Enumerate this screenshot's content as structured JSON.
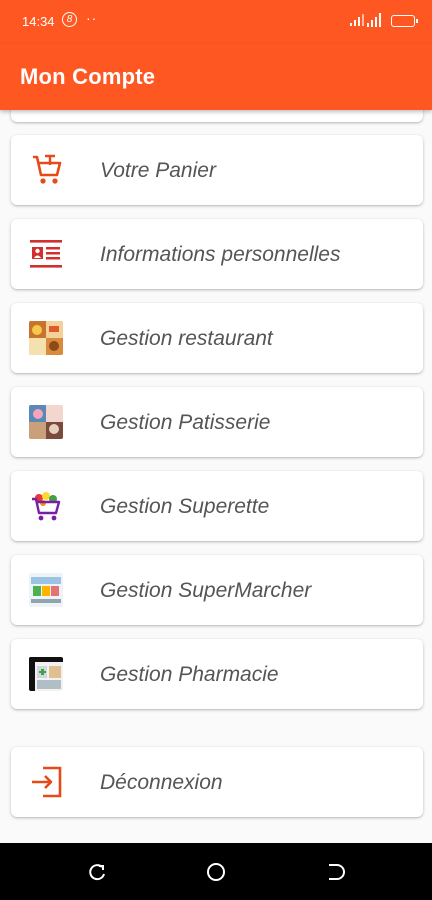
{
  "status_bar": {
    "time": "14:34",
    "badge": "8",
    "dots": "··"
  },
  "app_bar": {
    "title": "Mon Compte"
  },
  "menu": [
    {
      "label": "Votre Panier",
      "icon": "cart-icon"
    },
    {
      "label": "Informations personnelles",
      "icon": "id-card-icon"
    },
    {
      "label": "Gestion restaurant",
      "icon": "restaurant-thumbnail"
    },
    {
      "label": "Gestion Patisserie",
      "icon": "patisserie-thumbnail"
    },
    {
      "label": "Gestion Superette",
      "icon": "superette-thumbnail"
    },
    {
      "label": "Gestion SuperMarcher",
      "icon": "supermarche-thumbnail"
    },
    {
      "label": "Gestion Pharmacie",
      "icon": "pharmacie-thumbnail"
    }
  ],
  "logout": {
    "label": "Déconnexion",
    "icon": "logout-icon"
  },
  "colors": {
    "primary": "#ff5722",
    "text": "#555555",
    "navbar": "#000000"
  }
}
